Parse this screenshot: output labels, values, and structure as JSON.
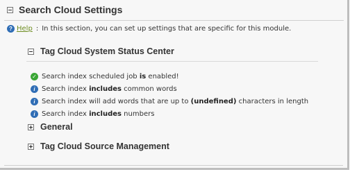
{
  "section": {
    "title": "Search Cloud Settings",
    "help_link": "Help",
    "help_separator": ":",
    "help_text": "In this section, you can set up settings that are specific for this module."
  },
  "status_center": {
    "title": "Tag Cloud System Status Center",
    "items": [
      {
        "icon": "check-icon",
        "parts": [
          "Search index scheduled job ",
          "is",
          " enabled!"
        ]
      },
      {
        "icon": "info-icon",
        "parts": [
          "Search index ",
          "includes",
          " common words"
        ]
      },
      {
        "icon": "info-icon",
        "parts": [
          "Search index will add words that are up to ",
          "(undefined)",
          " characters in length"
        ]
      },
      {
        "icon": "info-icon",
        "parts": [
          "Search index ",
          "includes",
          " numbers"
        ]
      }
    ]
  },
  "general": {
    "title": "General"
  },
  "source_management": {
    "title": "Tag Cloud Source Management"
  },
  "colors": {
    "help_link": "#6c8c1f",
    "info_icon": "#2f6db5",
    "check_icon": "#3aa635"
  }
}
